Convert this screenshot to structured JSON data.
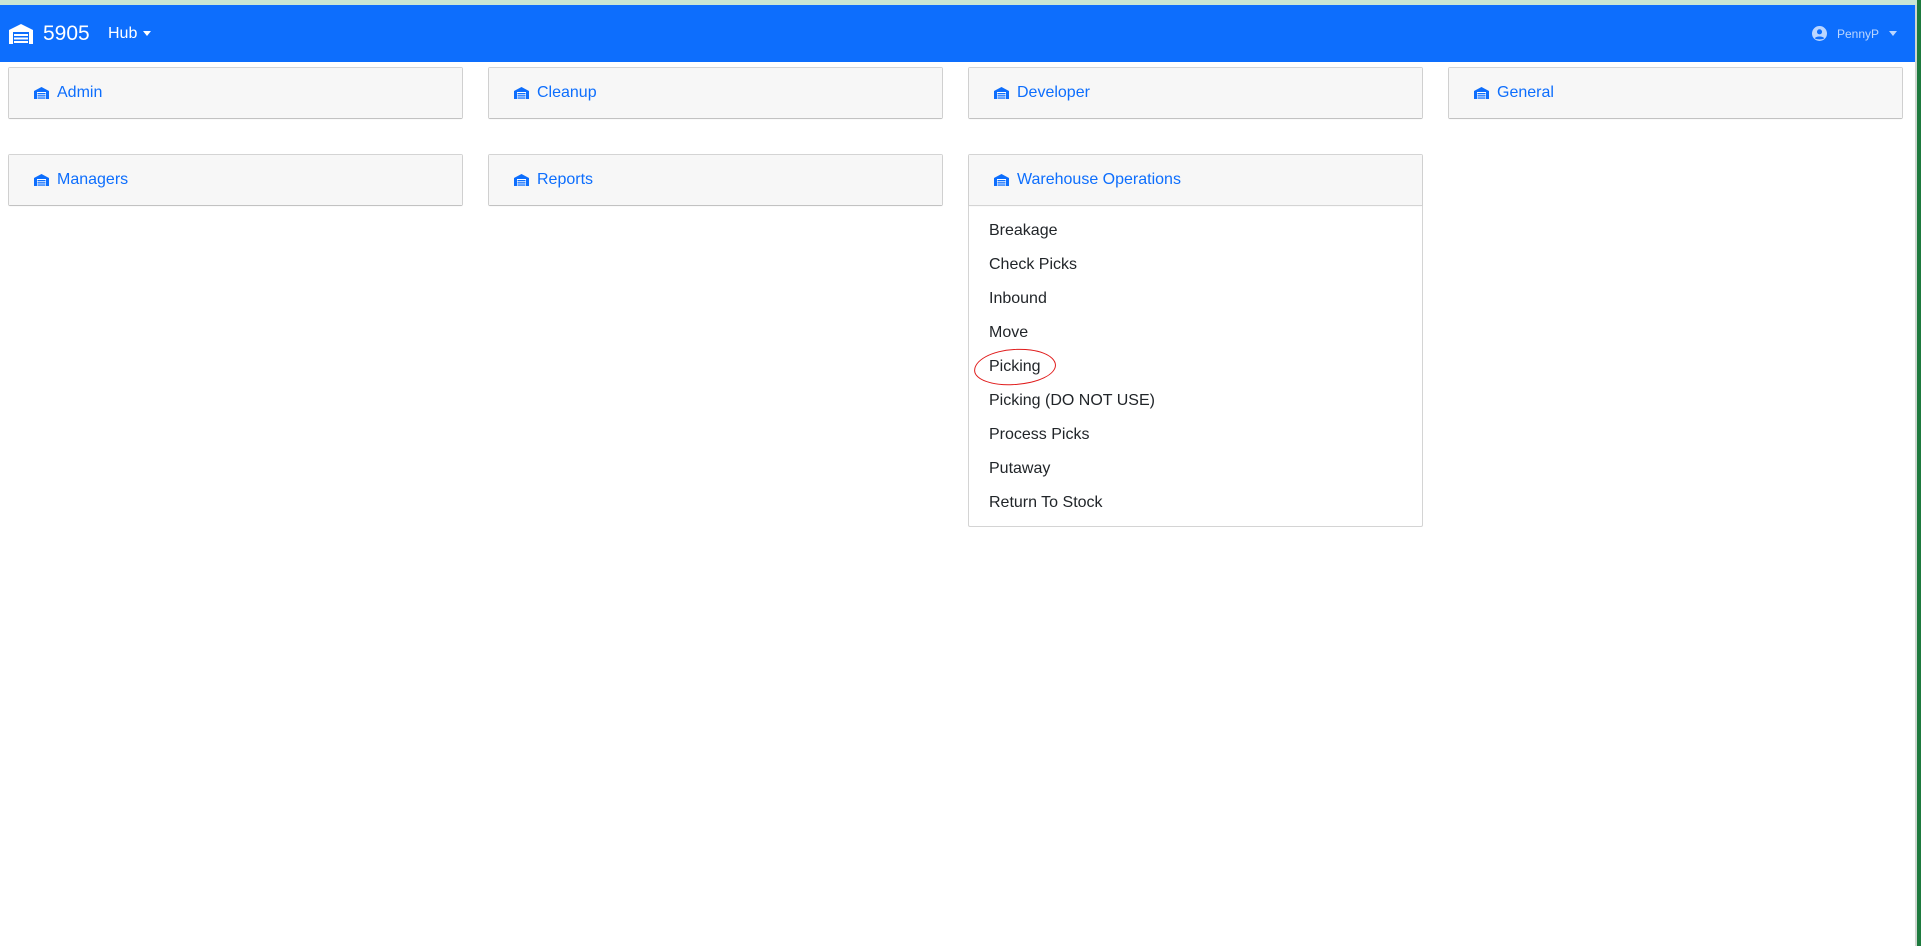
{
  "navbar": {
    "brand_number": "5905",
    "hub_label": "Hub",
    "user_name": "PennyP",
    "logo_icon": "warehouse-icon",
    "user_icon": "user-circle-icon",
    "background_color": "#0d6efd"
  },
  "cards": [
    {
      "title": "Admin"
    },
    {
      "title": "Cleanup"
    },
    {
      "title": "Developer"
    },
    {
      "title": "General"
    },
    {
      "title": "Managers"
    },
    {
      "title": "Reports"
    },
    {
      "title": "Warehouse Operations",
      "expanded": true,
      "items": [
        {
          "label": "Breakage"
        },
        {
          "label": "Check Picks"
        },
        {
          "label": "Inbound"
        },
        {
          "label": "Move"
        },
        {
          "label": "Picking",
          "annotated": true
        },
        {
          "label": "Picking (DO NOT USE)"
        },
        {
          "label": "Process Picks"
        },
        {
          "label": "Putaway"
        },
        {
          "label": "Return To Stock"
        }
      ]
    }
  ],
  "colors": {
    "link": "#0d6efd",
    "annotation": "#e01b1b"
  }
}
